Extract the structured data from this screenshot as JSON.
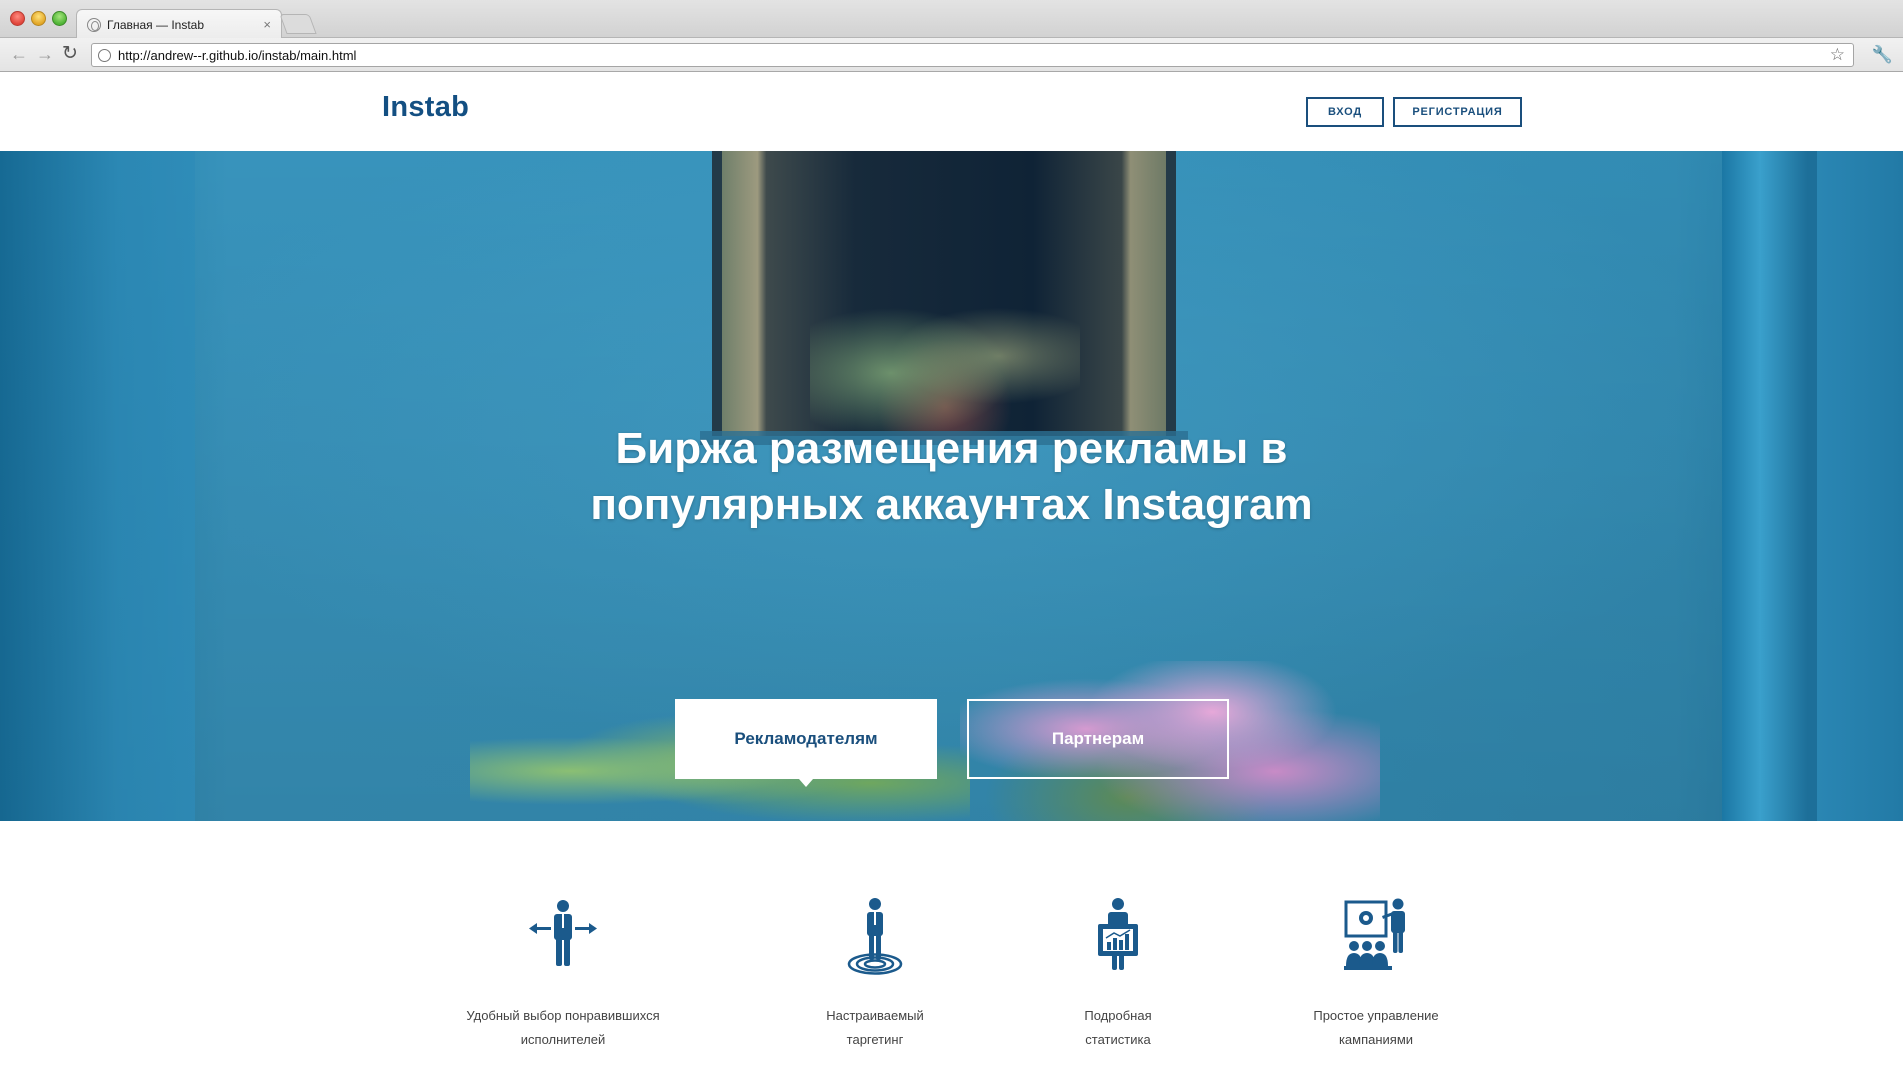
{
  "browser": {
    "tab_title": "Главная — Instab",
    "tab_close": "×",
    "url": "http://andrew--r.github.io/instab/main.html"
  },
  "header": {
    "logo": "Instab",
    "login_label": "ВХОД",
    "register_label": "РЕГИСТРАЦИЯ"
  },
  "hero": {
    "headline_line1": "Биржа размещения рекламы в",
    "headline_line2": "популярных аккаунтах Instagram",
    "cta_advertisers": "Рекламодателям",
    "cta_partners": "Партнерам"
  },
  "features": [
    {
      "icon": "person-arrows-icon",
      "line1": "Удобный выбор понравившихся",
      "line2": "исполнителей"
    },
    {
      "icon": "person-target-icon",
      "line1": "Настраиваемый",
      "line2": "таргетинг"
    },
    {
      "icon": "person-chart-icon",
      "line1": "Подробная",
      "line2": "статистика"
    },
    {
      "icon": "presentation-audience-icon",
      "line1": "Простое управление",
      "line2": "кампаниями"
    }
  ],
  "colors": {
    "brand": "#134f82",
    "hero_blue": "#3a9ac4",
    "icon_blue": "#1b5a8c"
  }
}
